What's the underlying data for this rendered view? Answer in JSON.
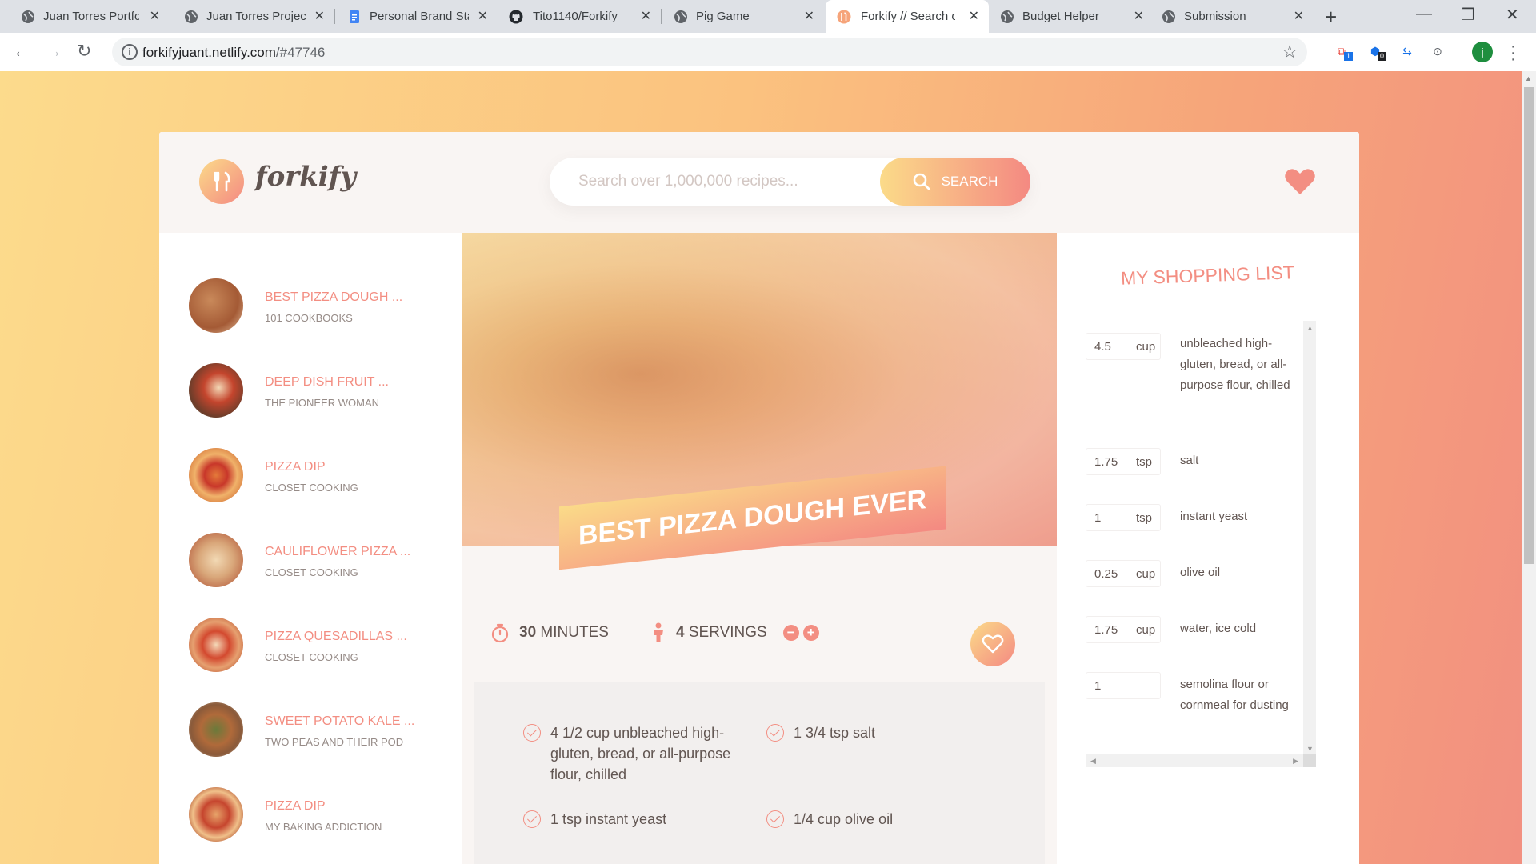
{
  "browser": {
    "tabs": [
      {
        "label": "Juan Torres Portfol",
        "active": false
      },
      {
        "label": "Juan Torres Project",
        "active": false
      },
      {
        "label": "Personal Brand Sta",
        "active": false
      },
      {
        "label": "Tito1140/Forkify",
        "active": false
      },
      {
        "label": "Pig Game",
        "active": false
      },
      {
        "label": "Forkify // Search o",
        "active": true
      },
      {
        "label": "Budget Helper",
        "active": false
      },
      {
        "label": "Submission",
        "active": false
      }
    ],
    "url_host": "forkifyjuant.netlify.com",
    "url_path": "/#47746",
    "ext_badge_1": "1",
    "ext_badge_2": "0",
    "profile_initial": "j"
  },
  "header": {
    "logo_text": "forkify",
    "search_placeholder": "Search over 1,000,000 recipes...",
    "search_button": "Search"
  },
  "results": [
    {
      "title": "Best Pizza Dough ...",
      "publisher": "101 Cookbooks",
      "active": true
    },
    {
      "title": "Deep Dish Fruit ...",
      "publisher": "The Pioneer Woman",
      "active": false
    },
    {
      "title": "Pizza Dip",
      "publisher": "Closet Cooking",
      "active": false
    },
    {
      "title": "Cauliflower Pizza ...",
      "publisher": "Closet Cooking",
      "active": false
    },
    {
      "title": "Pizza Quesadillas ...",
      "publisher": "Closet Cooking",
      "active": false
    },
    {
      "title": "Sweet Potato Kale ...",
      "publisher": "Two Peas and Their Pod",
      "active": false
    },
    {
      "title": "Pizza Dip",
      "publisher": "My Baking Addiction",
      "active": false
    }
  ],
  "recipe": {
    "title": "Best Pizza Dough Ever",
    "minutes": "30",
    "minutes_label": "minutes",
    "servings": "4",
    "servings_label": "servings",
    "ingredients": [
      "4 1/2 cup unbleached high-gluten, bread, or all-purpose flour, chilled",
      "1 3/4 tsp salt",
      "1 tsp instant yeast",
      "1/4 cup olive oil"
    ]
  },
  "shopping": {
    "heading": "My Shopping List",
    "items": [
      {
        "count": "4.5",
        "unit": "cup",
        "desc": "unbleached high-gluten, bread, or all-purpose flour, chilled"
      },
      {
        "count": "1.75",
        "unit": "tsp",
        "desc": "salt"
      },
      {
        "count": "1",
        "unit": "tsp",
        "desc": "instant yeast"
      },
      {
        "count": "0.25",
        "unit": "cup",
        "desc": "olive oil"
      },
      {
        "count": "1.75",
        "unit": "cup",
        "desc": "water, ice cold"
      },
      {
        "count": "1",
        "unit": "",
        "desc": "semolina flour or cornmeal for dusting"
      }
    ]
  },
  "colors": {
    "accent": "#f38e82",
    "gradient_start": "#fbdb89",
    "gradient_end": "#f48982",
    "text": "#615551",
    "muted": "#968b87",
    "panel": "#f9f5f3"
  }
}
